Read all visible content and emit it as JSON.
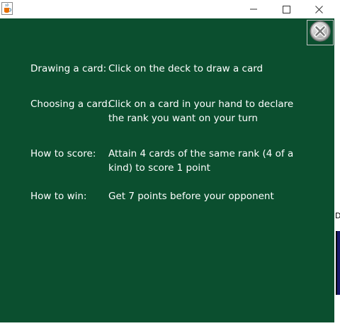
{
  "window": {
    "minimize_icon": "minimize-icon",
    "maximize_icon": "maximize-icon",
    "close_icon": "close-icon",
    "app_icon": "java-cup-icon"
  },
  "panel": {
    "background": "#0b4f2f",
    "close_button_icon": "circle-x-icon"
  },
  "instructions": [
    {
      "label": "Drawing a card:",
      "text": "Click on the deck to draw a card"
    },
    {
      "label": "Choosing a card:",
      "text": "Click on a card in your hand to declare the rank you want on your turn"
    },
    {
      "label": "How to score:",
      "text": "Attain 4 cards of the same rank (4 of a kind) to score 1 point"
    },
    {
      "label": "How to win:",
      "text": "Get 7 points before your opponent"
    }
  ],
  "background_window": {
    "edge_letter": "D"
  }
}
